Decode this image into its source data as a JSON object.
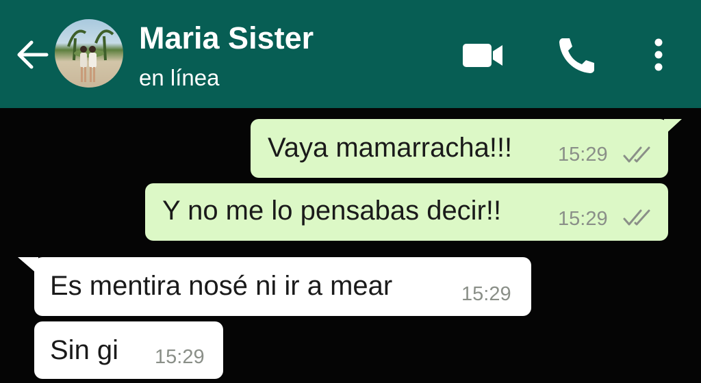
{
  "header": {
    "contact_name": "Maria Sister",
    "status": "en línea",
    "background_color": "#075e54",
    "icons": [
      "back-arrow-icon",
      "avatar",
      "video-call-icon",
      "phone-icon",
      "more-options-icon"
    ]
  },
  "messages": [
    {
      "direction": "outgoing",
      "text": "Vaya mamarracha!!!",
      "time": "15:29",
      "status_icon": "double-check-icon"
    },
    {
      "direction": "outgoing",
      "text": "Y no me lo pensabas decir!!",
      "time": "15:29",
      "status_icon": "double-check-icon"
    },
    {
      "direction": "incoming",
      "text": "Es mentira nosé ni ir a mear",
      "time": "15:29"
    },
    {
      "direction": "incoming",
      "text": "Sin gi",
      "time": "15:29"
    }
  ],
  "colors": {
    "outgoing_bubble": "#dcf8c6",
    "incoming_bubble": "#ffffff",
    "chat_background": "#050505"
  }
}
